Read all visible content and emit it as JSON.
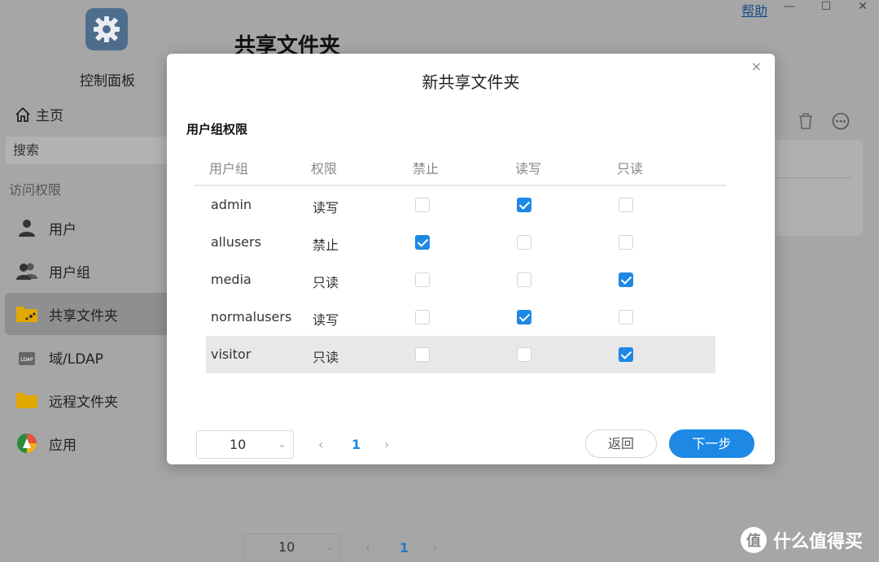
{
  "window": {
    "help_label": "帮助",
    "min": "—",
    "max": "☐",
    "close": "✕"
  },
  "app": {
    "title": "控制面板",
    "page_title": "共享文件夹"
  },
  "sidebar": {
    "home": "主页",
    "search_placeholder": "搜索",
    "section": "访问权限",
    "items": [
      {
        "label": "用户",
        "icon": "user-icon"
      },
      {
        "label": "用户组",
        "icon": "users-group-icon"
      },
      {
        "label": "共享文件夹",
        "icon": "shared-folder-icon",
        "active": true
      },
      {
        "label": "域/LDAP",
        "icon": "ldap-icon"
      },
      {
        "label": "远程文件夹",
        "icon": "folder-icon"
      },
      {
        "label": "应用",
        "icon": "app-icon"
      }
    ]
  },
  "background_pager": {
    "page_size": "10",
    "prev": "‹",
    "page": "1",
    "next": "›"
  },
  "watermark": {
    "logo": "值",
    "text": "什么值得买"
  },
  "modal": {
    "title": "新共享文件夹",
    "close": "×",
    "section_title": "用户组权限",
    "columns": [
      "用户组",
      "权限",
      "禁止",
      "读写",
      "只读"
    ],
    "rows": [
      {
        "group": "admin",
        "permission": "读写",
        "deny": false,
        "rw": true,
        "ro": false
      },
      {
        "group": "allusers",
        "permission": "禁止",
        "deny": true,
        "rw": false,
        "ro": false
      },
      {
        "group": "media",
        "permission": "只读",
        "deny": false,
        "rw": false,
        "ro": true
      },
      {
        "group": "normalusers",
        "permission": "读写",
        "deny": false,
        "rw": true,
        "ro": false
      },
      {
        "group": "visitor",
        "permission": "只读",
        "deny": false,
        "rw": false,
        "ro": true
      }
    ],
    "pager": {
      "page_size": "10",
      "prev": "‹",
      "page": "1",
      "next": "›"
    },
    "back_label": "返回",
    "next_label": "下一步"
  }
}
